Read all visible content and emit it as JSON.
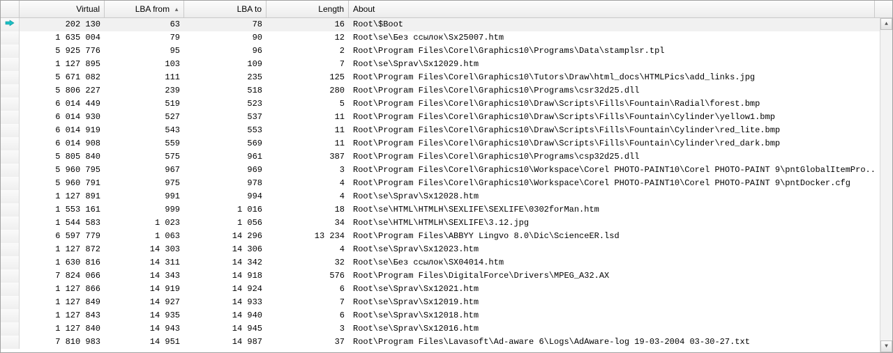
{
  "columns": {
    "virtual": "Virtual",
    "lba_from": "LBA from",
    "lba_to": "LBA to",
    "length": "Length",
    "about": "About",
    "sort_indicator": "▲"
  },
  "icons": {
    "current_row": "arrow"
  },
  "scroll": {
    "up": "▲",
    "down": "▼"
  },
  "rows": [
    {
      "virtual": "202 130",
      "lba_from": "63",
      "lba_to": "78",
      "length": "16",
      "about": "Root\\$Boot",
      "sel": true,
      "cur": true
    },
    {
      "virtual": "1 635 004",
      "lba_from": "79",
      "lba_to": "90",
      "length": "12",
      "about": "Root\\se\\Без ссылок\\Sx25007.htm"
    },
    {
      "virtual": "5 925 776",
      "lba_from": "95",
      "lba_to": "96",
      "length": "2",
      "about": "Root\\Program Files\\Corel\\Graphics10\\Programs\\Data\\stamplsr.tpl"
    },
    {
      "virtual": "1 127 895",
      "lba_from": "103",
      "lba_to": "109",
      "length": "7",
      "about": "Root\\se\\Sprav\\Sx12029.htm"
    },
    {
      "virtual": "5 671 082",
      "lba_from": "111",
      "lba_to": "235",
      "length": "125",
      "about": "Root\\Program Files\\Corel\\Graphics10\\Tutors\\Draw\\html_docs\\HTMLPics\\add_links.jpg"
    },
    {
      "virtual": "5 806 227",
      "lba_from": "239",
      "lba_to": "518",
      "length": "280",
      "about": "Root\\Program Files\\Corel\\Graphics10\\Programs\\csr32d25.dll"
    },
    {
      "virtual": "6 014 449",
      "lba_from": "519",
      "lba_to": "523",
      "length": "5",
      "about": "Root\\Program Files\\Corel\\Graphics10\\Draw\\Scripts\\Fills\\Fountain\\Radial\\forest.bmp"
    },
    {
      "virtual": "6 014 930",
      "lba_from": "527",
      "lba_to": "537",
      "length": "11",
      "about": "Root\\Program Files\\Corel\\Graphics10\\Draw\\Scripts\\Fills\\Fountain\\Cylinder\\yellow1.bmp"
    },
    {
      "virtual": "6 014 919",
      "lba_from": "543",
      "lba_to": "553",
      "length": "11",
      "about": "Root\\Program Files\\Corel\\Graphics10\\Draw\\Scripts\\Fills\\Fountain\\Cylinder\\red_lite.bmp"
    },
    {
      "virtual": "6 014 908",
      "lba_from": "559",
      "lba_to": "569",
      "length": "11",
      "about": "Root\\Program Files\\Corel\\Graphics10\\Draw\\Scripts\\Fills\\Fountain\\Cylinder\\red_dark.bmp"
    },
    {
      "virtual": "5 805 840",
      "lba_from": "575",
      "lba_to": "961",
      "length": "387",
      "about": "Root\\Program Files\\Corel\\Graphics10\\Programs\\csp32d25.dll"
    },
    {
      "virtual": "5 960 795",
      "lba_from": "967",
      "lba_to": "969",
      "length": "3",
      "about": "Root\\Program Files\\Corel\\Graphics10\\Workspace\\Corel PHOTO-PAINT10\\Corel PHOTO-PAINT 9\\pntGlobalItemPro..."
    },
    {
      "virtual": "5 960 791",
      "lba_from": "975",
      "lba_to": "978",
      "length": "4",
      "about": "Root\\Program Files\\Corel\\Graphics10\\Workspace\\Corel PHOTO-PAINT10\\Corel PHOTO-PAINT 9\\pntDocker.cfg"
    },
    {
      "virtual": "1 127 891",
      "lba_from": "991",
      "lba_to": "994",
      "length": "4",
      "about": "Root\\se\\Sprav\\Sx12028.htm"
    },
    {
      "virtual": "1 553 161",
      "lba_from": "999",
      "lba_to": "1 016",
      "length": "18",
      "about": "Root\\se\\HTML\\HTMLH\\SEXLIFE\\SEXLIFE\\0302forMan.htm"
    },
    {
      "virtual": "1 544 583",
      "lba_from": "1 023",
      "lba_to": "1 056",
      "length": "34",
      "about": "Root\\se\\HTML\\HTMLH\\SEXLIFE\\3.12.jpg"
    },
    {
      "virtual": "6 597 779",
      "lba_from": "1 063",
      "lba_to": "14 296",
      "length": "13 234",
      "about": "Root\\Program Files\\ABBYY Lingvo 8.0\\Dic\\ScienceER.lsd"
    },
    {
      "virtual": "1 127 872",
      "lba_from": "14 303",
      "lba_to": "14 306",
      "length": "4",
      "about": "Root\\se\\Sprav\\Sx12023.htm"
    },
    {
      "virtual": "1 630 816",
      "lba_from": "14 311",
      "lba_to": "14 342",
      "length": "32",
      "about": "Root\\se\\Без ссылок\\SX04014.htm"
    },
    {
      "virtual": "7 824 066",
      "lba_from": "14 343",
      "lba_to": "14 918",
      "length": "576",
      "about": "Root\\Program Files\\DigitalForce\\Drivers\\MPEG_A32.AX"
    },
    {
      "virtual": "1 127 866",
      "lba_from": "14 919",
      "lba_to": "14 924",
      "length": "6",
      "about": "Root\\se\\Sprav\\Sx12021.htm"
    },
    {
      "virtual": "1 127 849",
      "lba_from": "14 927",
      "lba_to": "14 933",
      "length": "7",
      "about": "Root\\se\\Sprav\\Sx12019.htm"
    },
    {
      "virtual": "1 127 843",
      "lba_from": "14 935",
      "lba_to": "14 940",
      "length": "6",
      "about": "Root\\se\\Sprav\\Sx12018.htm"
    },
    {
      "virtual": "1 127 840",
      "lba_from": "14 943",
      "lba_to": "14 945",
      "length": "3",
      "about": "Root\\se\\Sprav\\Sx12016.htm"
    },
    {
      "virtual": "7 810 983",
      "lba_from": "14 951",
      "lba_to": "14 987",
      "length": "37",
      "about": "Root\\Program Files\\Lavasoft\\Ad-aware 6\\Logs\\AdAware-log 19-03-2004 03-30-27.txt"
    }
  ]
}
